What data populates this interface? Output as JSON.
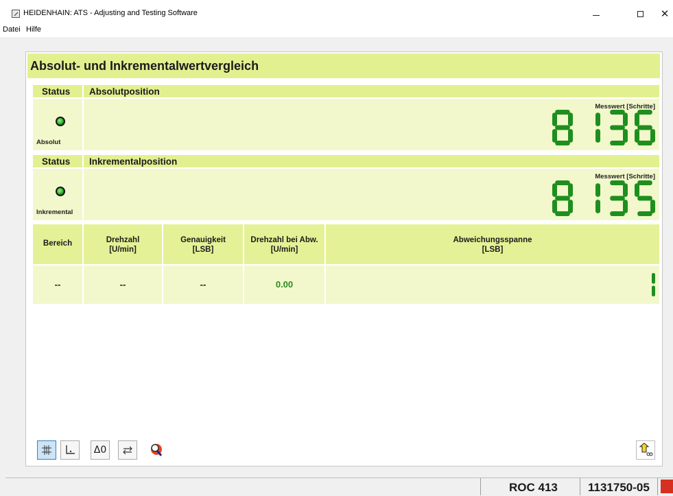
{
  "window": {
    "title": "HEIDENHAIN: ATS - Adjusting and Testing Software"
  },
  "menu": [
    "Datei",
    "Hilfe"
  ],
  "panel": {
    "title": "Absolut- und Inkrementalwertvergleich",
    "absolute": {
      "status_header": "Status",
      "section_header": "Absolutposition",
      "led_label": "Absolut",
      "measure_label": "Messwert [Schritte]",
      "value": "8136"
    },
    "incremental": {
      "status_header": "Status",
      "section_header": "Inkrementalposition",
      "led_label": "Inkremental",
      "measure_label": "Messwert [Schritte]",
      "value": "8135"
    },
    "table": {
      "headers": [
        {
          "line1": "Bereich",
          "line2": ""
        },
        {
          "line1": "Drehzahl",
          "line2": "[U/min]"
        },
        {
          "line1": "Genauigkeit",
          "line2": "[LSB]"
        },
        {
          "line1": "Drehzahl bei Abw.",
          "line2": "[U/min]"
        },
        {
          "line1": "Abweichungsspanne",
          "line2": "[LSB]"
        }
      ],
      "row": [
        "--",
        "--",
        "--",
        "0.00"
      ],
      "deviation_value": "1"
    },
    "led_color": "#3cc03a",
    "digit_color": "#1e8f1e",
    "accent": "#e3f090"
  },
  "toolbar": {
    "buttons": [
      "grid-icon",
      "axis-icon",
      "delta-zero-button",
      "swap-icon",
      "magnifier-icon"
    ],
    "delta_label": "Δ0"
  },
  "statusbar": {
    "device": "ROC 413",
    "id": "1131750-05"
  }
}
